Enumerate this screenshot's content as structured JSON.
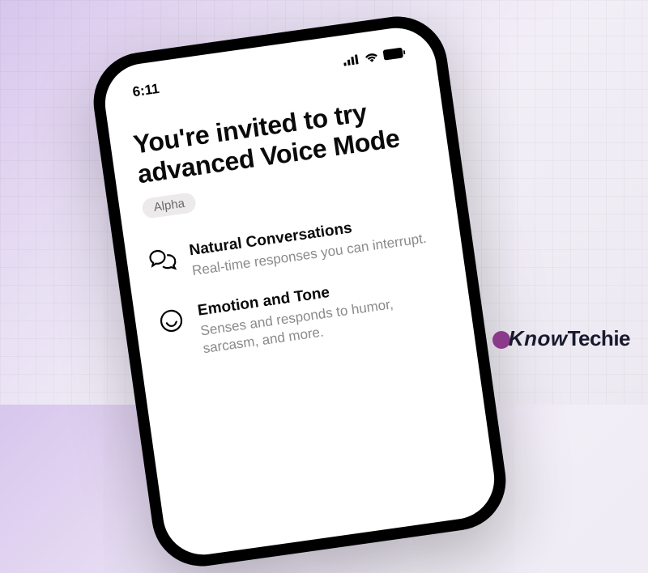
{
  "status": {
    "time": "6:11"
  },
  "headline": "You're invited to try advanced Voice Mode",
  "badge": "Alpha",
  "features": [
    {
      "title": "Natural Conversations",
      "desc": "Real-time responses you can interrupt."
    },
    {
      "title": "Emotion and Tone",
      "desc": "Senses and responds to humor, sarcasm, and more."
    }
  ],
  "watermark": {
    "part1": "Know",
    "part2": "Techie"
  }
}
